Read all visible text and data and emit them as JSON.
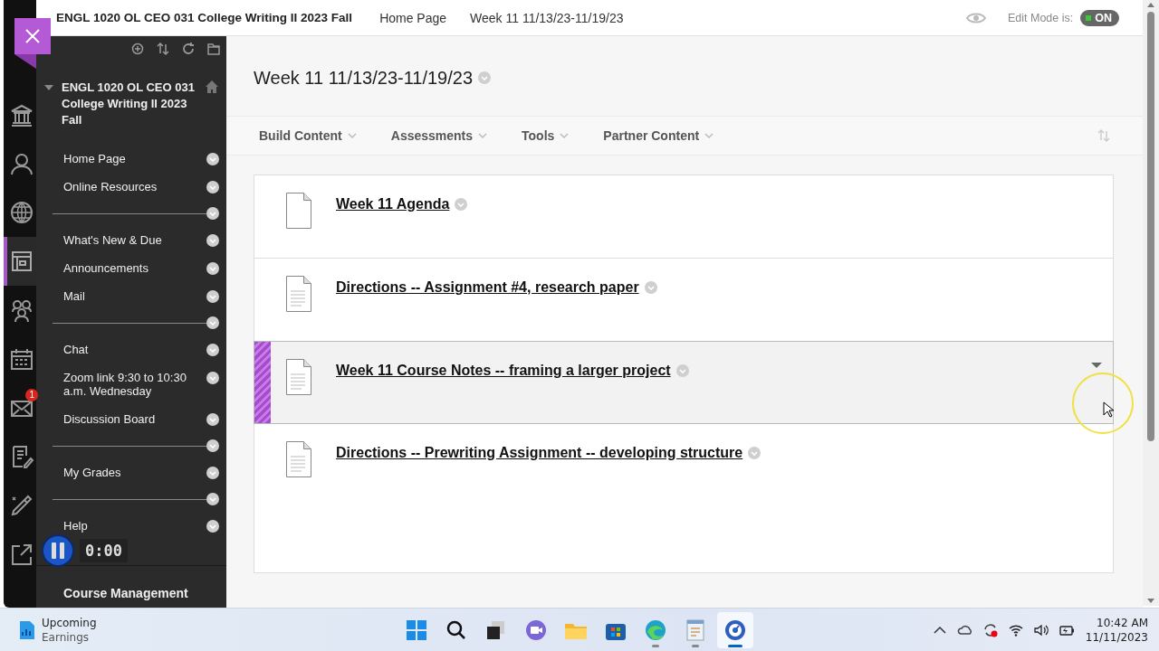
{
  "header": {
    "course_title": "ENGL 1020 OL CEO 031 College Writing II 2023 Fall",
    "breadcrumbs": [
      "Home Page",
      "Week 11 11/13/23-11/19/23"
    ],
    "edit_mode": {
      "label": "Edit Mode is:",
      "on": true,
      "state_text": "ON"
    }
  },
  "rail": {
    "items": [
      {
        "kind": "institution",
        "selected": false
      },
      {
        "kind": "profile",
        "selected": false
      },
      {
        "kind": "globe",
        "selected": false
      },
      {
        "kind": "courses",
        "selected": true
      },
      {
        "kind": "groups",
        "selected": false
      },
      {
        "kind": "calendar",
        "selected": false
      },
      {
        "kind": "mail",
        "selected": false,
        "badge": "1"
      },
      {
        "kind": "grades",
        "selected": false
      },
      {
        "kind": "tools",
        "selected": false
      },
      {
        "kind": "signout",
        "selected": false
      }
    ]
  },
  "sidebar": {
    "course_title": "ENGL 1020 OL CEO 031 College Writing II 2023 Fall",
    "items": [
      {
        "kind": "link",
        "label": "Home Page"
      },
      {
        "kind": "link",
        "label": "Online Resources"
      },
      {
        "kind": "divider"
      },
      {
        "kind": "link",
        "label": "What's New & Due"
      },
      {
        "kind": "link",
        "label": "Announcements"
      },
      {
        "kind": "link",
        "label": "Mail"
      },
      {
        "kind": "divider"
      },
      {
        "kind": "link",
        "label": "Chat"
      },
      {
        "kind": "link",
        "label": "Zoom link 9:30 to 10:30 a.m. Wednesday"
      },
      {
        "kind": "link",
        "label": "Discussion Board"
      },
      {
        "kind": "divider"
      },
      {
        "kind": "link",
        "label": "My Grades"
      },
      {
        "kind": "divider"
      },
      {
        "kind": "link",
        "label": "Help"
      }
    ],
    "footer": "Course Management"
  },
  "recorder": {
    "time": "0:00"
  },
  "page": {
    "title": "Week 11 11/13/23-11/19/23",
    "menus": [
      "Build Content",
      "Assessments",
      "Tools",
      "Partner Content"
    ],
    "items": [
      {
        "kind": "blank",
        "title": "Week 11 Agenda",
        "selected": false
      },
      {
        "kind": "text",
        "title": "Directions -- Assignment #4, research paper",
        "selected": false
      },
      {
        "kind": "text",
        "title": "Week 11 Course Notes -- framing a larger project",
        "selected": true
      },
      {
        "kind": "text",
        "title": "Directions -- Prewriting Assignment -- developing structure",
        "selected": false
      }
    ]
  },
  "taskbar": {
    "widget": {
      "title": "Upcoming",
      "subtitle": "Earnings"
    },
    "apps": [
      {
        "kind": "start",
        "running": false,
        "selected": false
      },
      {
        "kind": "search",
        "running": false,
        "selected": false
      },
      {
        "kind": "taskview",
        "running": false,
        "selected": false
      },
      {
        "kind": "chat",
        "running": false,
        "selected": false
      },
      {
        "kind": "explorer",
        "running": false,
        "selected": false
      },
      {
        "kind": "store",
        "running": false,
        "selected": false
      },
      {
        "kind": "edge",
        "running": true,
        "selected": false
      },
      {
        "kind": "notepad",
        "running": true,
        "selected": false
      },
      {
        "kind": "recorder",
        "running": true,
        "selected": true
      }
    ],
    "clock": {
      "time": "10:42 AM",
      "date": "11/11/2023"
    }
  }
}
